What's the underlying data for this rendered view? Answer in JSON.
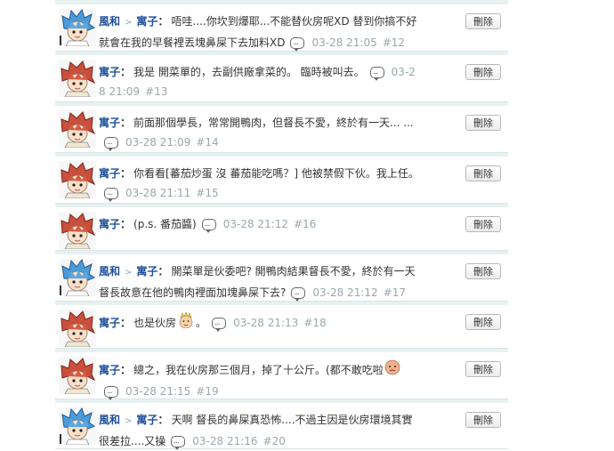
{
  "comments": [
    {
      "author": "風和",
      "reply_to": "寓子",
      "text": "唔哇....你坎到爆耶...不能替伙房呢XD 替到你搞不好就會在我的早餐裡丟塊鼻屎下去加料XD",
      "time": "03-28 21:05",
      "number": "#12",
      "avatar": "blue-hair-avatar"
    },
    {
      "author": "寓子",
      "reply_to": "",
      "text": "我是 開菜單的，去副供廠拿菜的。 臨時被叫去。",
      "time": "03-28 21:09",
      "number": "#13",
      "avatar": "red-hair-avatar"
    },
    {
      "author": "寓子",
      "reply_to": "",
      "text": "前面那個學長，常常開鴨肉，但督長不愛，終於有一天... ...",
      "time": "03-28 21:09",
      "number": "#14",
      "avatar": "red-hair-avatar"
    },
    {
      "author": "寓子",
      "reply_to": "",
      "text": "你看看[蕃茄炒蛋 沒 蕃茄能吃嗎？] 他被禁假下伙。我上任。",
      "time": "03-28 21:11",
      "number": "#15",
      "avatar": "red-hair-avatar"
    },
    {
      "author": "寓子",
      "reply_to": "",
      "text": "(p.s. 番茄醬)",
      "time": "03-28 21:12",
      "number": "#16",
      "avatar": "red-hair-avatar"
    },
    {
      "author": "風和",
      "reply_to": "寓子",
      "text": "開菜單是伙委吧? 開鴨肉結果督長不愛，終於有一天督長故意在他的鴨肉裡面加塊鼻屎下去?",
      "time": "03-28 21:12",
      "number": "#17",
      "avatar": "blue-hair-avatar"
    },
    {
      "author": "寓子",
      "reply_to": "",
      "text": "也是伙房",
      "suffix": "。",
      "time": "03-28 21:13",
      "number": "#18",
      "avatar": "red-hair-avatar",
      "emoji": "king-face-emoji"
    },
    {
      "author": "寓子",
      "reply_to": "",
      "text": "總之，我在伙房那三個月，掉了十公斤。(都不敢吃啦",
      "time": "03-28 21:15",
      "number": "#19",
      "avatar": "red-hair-avatar",
      "emoji": "sad-face-emoji"
    },
    {
      "author": "風和",
      "reply_to": "寓子",
      "text": "天啊 督長的鼻屎真恐怖....不過主因是伙房環境其實很差拉....又操",
      "time": "03-28 21:16",
      "number": "#20",
      "avatar": "blue-hair-avatar"
    }
  ],
  "delete_label": "刪除",
  "arrow_symbol": ">",
  "colon_symbol": "："
}
